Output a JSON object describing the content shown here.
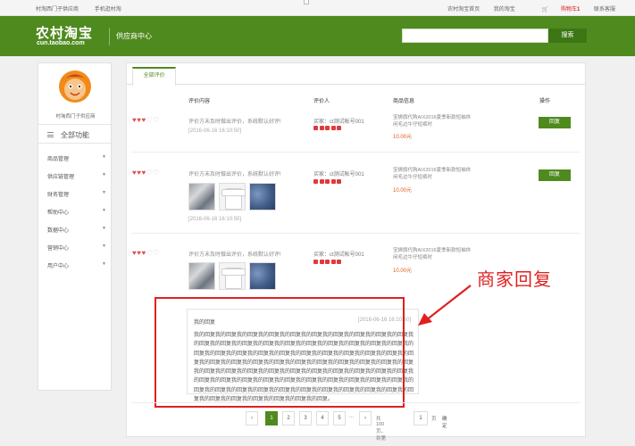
{
  "topbar": {
    "left_links": [
      "村淘西门子供应商",
      "手机逛村淘"
    ],
    "right_links": [
      "农村淘宝首页",
      "我的淘宝"
    ],
    "cart_label": "购物车",
    "cart_count": "1",
    "contact": "联系客服"
  },
  "header": {
    "logo_cn": "农村淘宝",
    "logo_en": "cun.taobao.com",
    "title": "供应商中心",
    "search_value": "",
    "search_btn": "搜索"
  },
  "sidebar": {
    "store_name": "村淘西门子供应商",
    "all_functions": "全部功能",
    "items": [
      "商品管理",
      "供应链管理",
      "财务管理",
      "帮助中心",
      "数据中心",
      "营销中心",
      "用户中心"
    ]
  },
  "tabs": [
    "全部评价"
  ],
  "columns": {
    "content": "评价内容",
    "reviewer": "评价人",
    "product": "商品信息",
    "action": "操作"
  },
  "reviews": [
    {
      "hearts_filled": 3,
      "hearts_total": 5,
      "text": "评价方未及时做出评价，系统默认好评!",
      "date": "[2016-06-16 16:10:50]",
      "buyer": "买家：ct测试帐号001",
      "rating": 5,
      "product": "宝狮旗代购AIX2016夏季新款短袖休闲毛边牛仔短裤时",
      "price": "10.00元",
      "reply_btn": "回复",
      "has_images": false
    },
    {
      "hearts_filled": 3,
      "hearts_total": 5,
      "text": "评价方未及时做出评价，系统默认好评!",
      "date": "[2016-06-16 16:10:50]",
      "buyer": "买家：ct测试帐号001",
      "rating": 5,
      "product": "宝狮旗代购AIX2016夏季新款短袖休闲毛边牛仔短裤时",
      "price": "10.00元",
      "reply_btn": "回复",
      "has_images": true
    },
    {
      "hearts_filled": 3,
      "hearts_total": 5,
      "text": "评价方未及时做出评价，系统默认好评!",
      "date": "[2016-06-16 16:10:50]",
      "buyer": "买家：ct测试帐号001",
      "rating": 5,
      "product": "宝狮旗代购AIX2016夏季新款短袖休闲毛边牛仔短裤时",
      "price": "10.00元",
      "has_images": true
    }
  ],
  "reply": {
    "title": "我的回复",
    "date": "[2016-06-16 16:10:50]",
    "body": "我的回复我的回复我的回复我的回复我的回复我的回复我的回复我的回复我的回复我的回复我的回复我的回复我的回复我的回复我的回复我的回复我的回复我的回复我的回复我的回复我的回复我的回复我的回复我的回复我的回复我的回复我的回复我的回复我的回复我的回复我的回复我的回复我的回复我的回复我的回复我的回复我的回复我的回复我的回复我的回复我的回复我的回复我的回复我的回复我的回复我的回复我的回复我的回复我的回复我的回复我的回复我的回复我的回复我的回复我的回复我的回复我的回复我的回复我的回复我的回复我的回复我的回复我的回复我的回复我的回复我的回复我的回复我的回复我的回复我的回复我的回复我的回复我的回复我的回复我的回复我的回复我的回复我的回复。"
  },
  "pagination": {
    "prev": "‹",
    "pages": [
      "1",
      "2",
      "3",
      "4",
      "5"
    ],
    "active_page": "1",
    "ellipsis": "...",
    "next": "›",
    "total_text": "共100页，到第",
    "input_value": "1",
    "page_unit": "页",
    "confirm": "确定"
  },
  "annotation": "商家回复",
  "colors": {
    "brand_green": "#4f8a1e",
    "heart_red": "#e05050",
    "annotation_red": "#e02020",
    "price_orange": "#e05a1a"
  },
  "icons": [
    "avatar-mascot-icon",
    "hamburger-menu-icon",
    "chevron-down-icon",
    "heart-icon",
    "cart-icon",
    "arrow-annotation-icon"
  ]
}
